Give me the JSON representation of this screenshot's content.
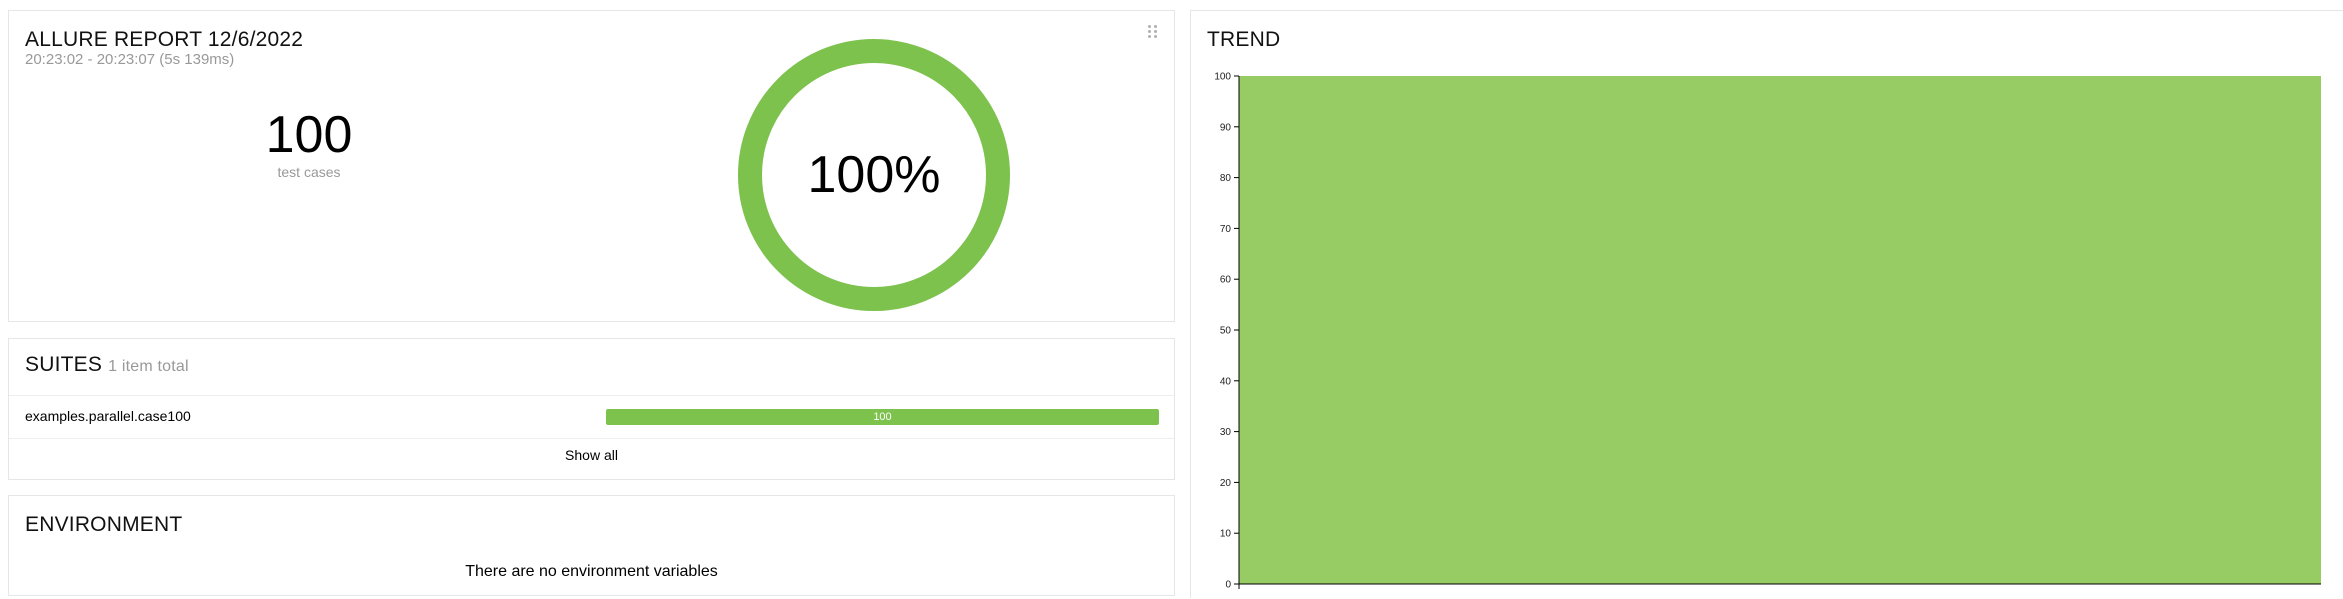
{
  "summary": {
    "title": "ALLURE REPORT 12/6/2022",
    "time_range": "20:23:02 - 20:23:07 (5s 139ms)",
    "test_count": "100",
    "test_count_label": "test cases",
    "success_rate_text": "100%",
    "success_rate": 1.0,
    "drag_icon": "grip-icon"
  },
  "suites": {
    "title": "SUITES",
    "subtitle": "1 item total",
    "items": [
      {
        "name": "examples.parallel.case100",
        "passed": 100,
        "passed_label": "100",
        "fraction": 1.0
      }
    ],
    "show_all": "Show all"
  },
  "environment": {
    "title": "ENVIRONMENT",
    "empty_message": "There are no environment variables"
  },
  "trend": {
    "title": "TREND"
  },
  "colors": {
    "passed": "#7dc24c",
    "trend_area": "#97cc64",
    "donut": "#7dc24c"
  },
  "chart_data": {
    "type": "area",
    "title": "TREND",
    "xlabel": "",
    "ylabel": "",
    "ylim": [
      0,
      100
    ],
    "yticks": [
      0,
      10,
      20,
      30,
      40,
      50,
      60,
      70,
      80,
      90,
      100
    ],
    "series": [
      {
        "values": [
          100,
          100
        ]
      }
    ],
    "grid": false
  }
}
